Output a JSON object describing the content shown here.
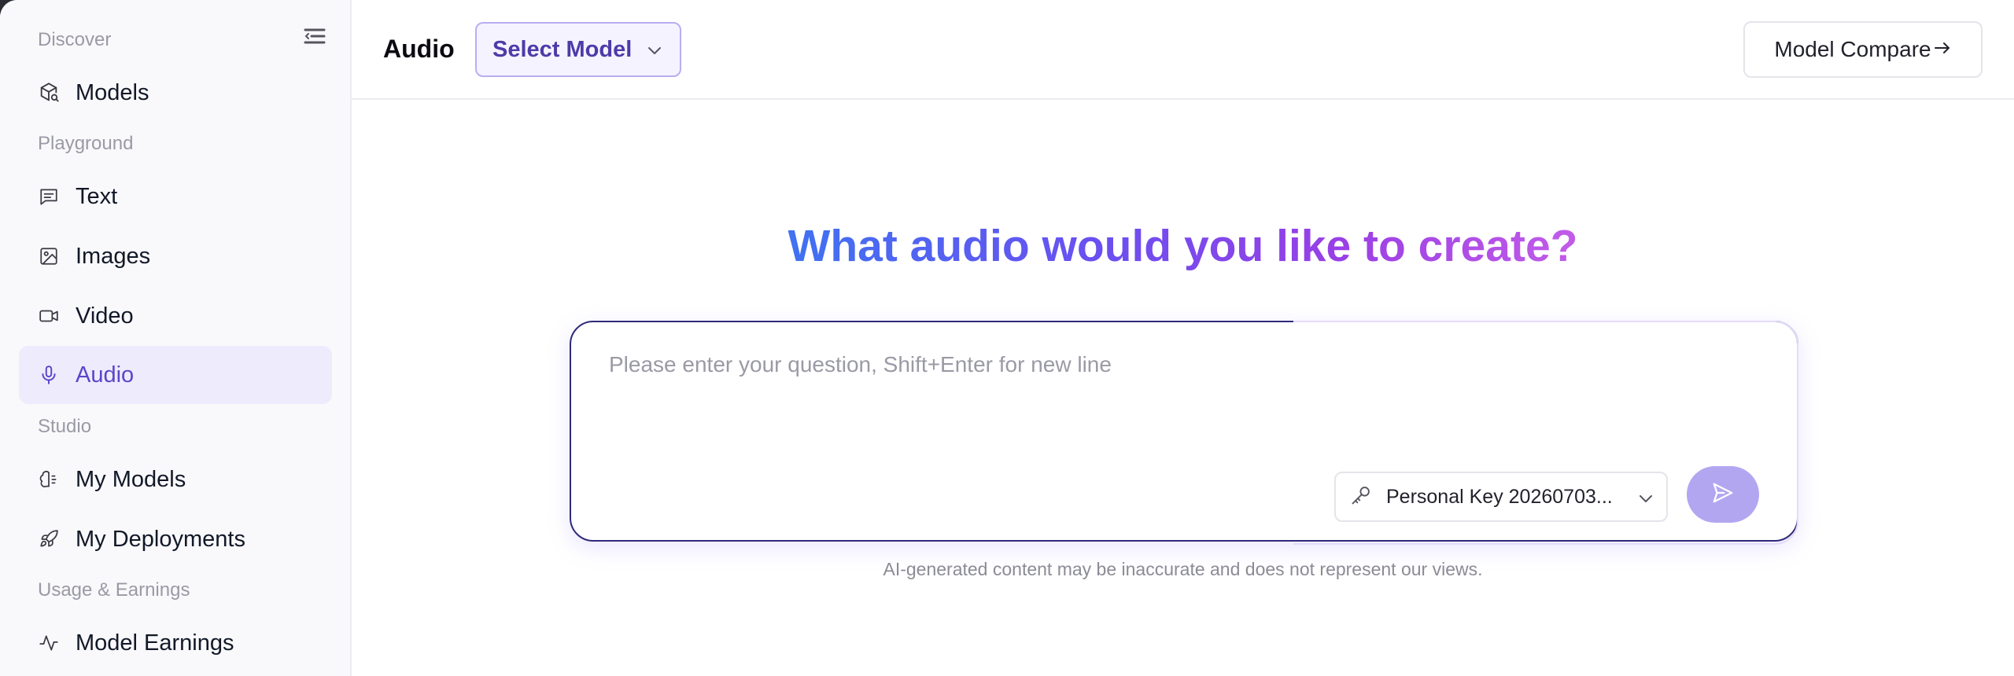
{
  "sidebar": {
    "sections": {
      "discover": "Discover",
      "playground": "Playground",
      "studio": "Studio",
      "usage": "Usage & Earnings"
    },
    "items": {
      "models": "Models",
      "text": "Text",
      "images": "Images",
      "video": "Video",
      "audio": "Audio",
      "my_models": "My Models",
      "my_deployments": "My Deployments",
      "model_earnings": "Model Earnings"
    },
    "active_item": "audio"
  },
  "header": {
    "title": "Audio",
    "model_select_label": "Select Model",
    "compare_label": "Model Compare"
  },
  "main": {
    "hero_title": "What audio would you like to create?",
    "prompt_placeholder": "Please enter your question, Shift+Enter for new line",
    "prompt_value": "",
    "key_select_label": "Personal Key 20260703...",
    "disclaimer": "AI-generated content may be inaccurate and does not represent our views."
  },
  "colors": {
    "accent": "#5b45c9",
    "active_bg": "#eeebfd",
    "send_button": "#b3a6f1"
  },
  "icons": {
    "collapse": "collapse-menu-icon",
    "models": "cube-search-icon",
    "text": "chat-lines-icon",
    "images": "image-icon",
    "video": "video-camera-icon",
    "audio": "microphone-icon",
    "my_models": "brain-icon",
    "my_deployments": "rocket-icon",
    "model_earnings": "activity-icon",
    "key": "key-icon",
    "send": "send-icon"
  }
}
